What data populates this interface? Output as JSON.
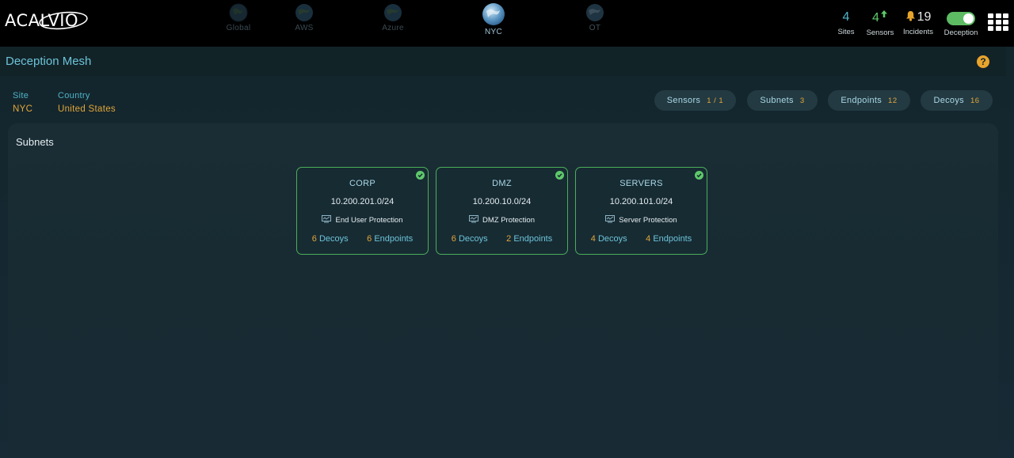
{
  "brand": {
    "logo_text": "ACALVIO"
  },
  "site_tabs": [
    {
      "label": "Global",
      "state": "dim"
    },
    {
      "label": "AWS",
      "state": "dim"
    },
    {
      "label": "Azure",
      "state": "dim"
    },
    {
      "label": "NYC",
      "state": "active"
    },
    {
      "label": "OT",
      "state": "dim"
    }
  ],
  "stats": {
    "sites": {
      "value": "4",
      "label": "Sites"
    },
    "sensors": {
      "value": "4",
      "label": "Sensors",
      "icon": "arrow-up-icon"
    },
    "incidents": {
      "value": "19",
      "label": "Incidents",
      "icon": "bell-icon"
    },
    "deception": {
      "label": "Deception",
      "enabled": true
    }
  },
  "page": {
    "title": "Deception Mesh",
    "help_icon": "?"
  },
  "info": {
    "site_key": "Site",
    "site_value": "NYC",
    "country_key": "Country",
    "country_value": "United States"
  },
  "pills": [
    {
      "label": "Sensors",
      "value": "1 / 1"
    },
    {
      "label": "Subnets",
      "value": "3"
    },
    {
      "label": "Endpoints",
      "value": "12"
    },
    {
      "label": "Decoys",
      "value": "16"
    }
  ],
  "subnets": {
    "title": "Subnets",
    "decoys_label": "Decoys",
    "endpoints_label": "Endpoints",
    "cards": [
      {
        "name": "CORP",
        "cidr": "10.200.201.0/24",
        "profile": "End User Protection",
        "decoys": "6",
        "endpoints": "6"
      },
      {
        "name": "DMZ",
        "cidr": "10.200.10.0/24",
        "profile": "DMZ Protection",
        "decoys": "6",
        "endpoints": "2"
      },
      {
        "name": "SERVERS",
        "cidr": "10.200.101.0/24",
        "profile": "Server Protection",
        "decoys": "4",
        "endpoints": "4"
      }
    ]
  },
  "colors": {
    "accent": "#4fb3c9",
    "count": "#e0a63a",
    "ok": "#5ec96a",
    "warning": "#e8a42c"
  }
}
